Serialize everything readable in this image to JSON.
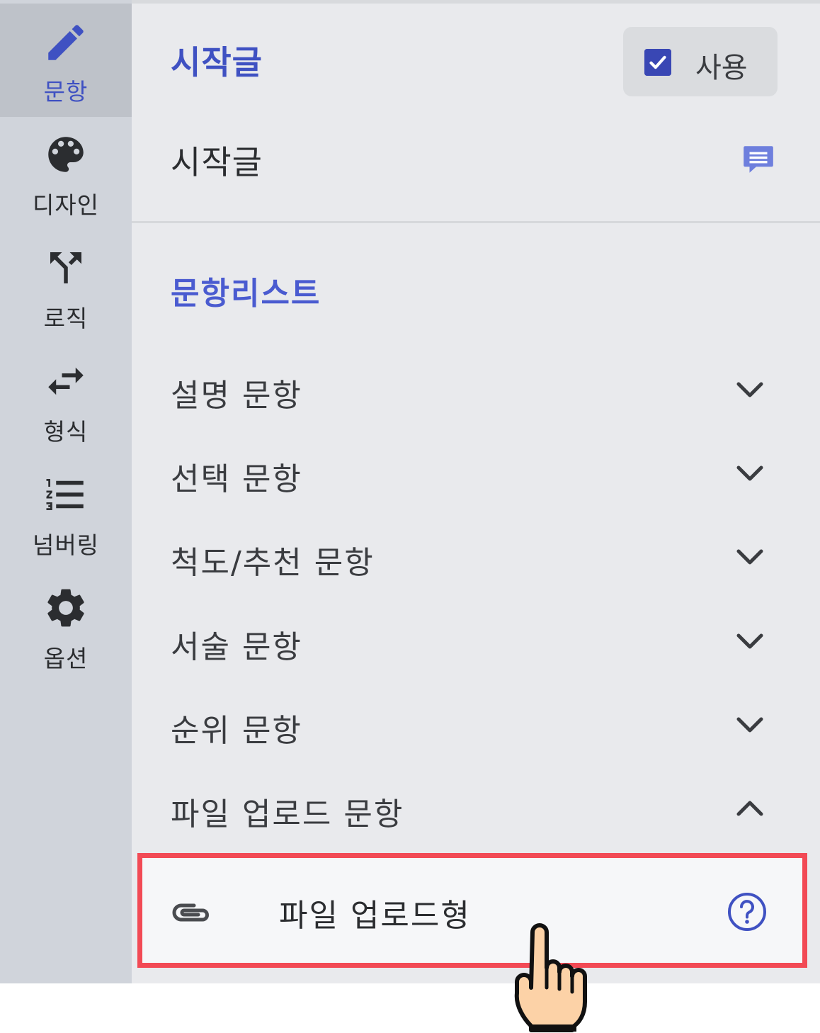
{
  "sidebar": {
    "items": [
      {
        "label": "문항",
        "icon": "pencil-icon",
        "active": true
      },
      {
        "label": "디자인",
        "icon": "palette-icon",
        "active": false
      },
      {
        "label": "로직",
        "icon": "fork-arrows-icon",
        "active": false
      },
      {
        "label": "형식",
        "icon": "swap-arrows-icon",
        "active": false
      },
      {
        "label": "넘버링",
        "icon": "numbered-list-icon",
        "active": false
      },
      {
        "label": "옵션",
        "icon": "gear-icon",
        "active": false
      }
    ]
  },
  "intro": {
    "title": "시작글",
    "use_label": "사용",
    "use_checked": true,
    "text": "시작글"
  },
  "question_list": {
    "title": "문항리스트",
    "categories": [
      {
        "label": "설명 문항",
        "expanded": false
      },
      {
        "label": "선택 문항",
        "expanded": false
      },
      {
        "label": "척도/추천 문항",
        "expanded": false
      },
      {
        "label": "서술 문항",
        "expanded": false
      },
      {
        "label": "순위 문항",
        "expanded": false
      },
      {
        "label": "파일 업로드 문항",
        "expanded": true
      }
    ],
    "expanded_items": [
      {
        "label": "파일 업로드형",
        "icon": "paperclip-icon"
      }
    ]
  },
  "colors": {
    "accent": "#3f51c2",
    "highlight": "#f24a55",
    "sidebar_bg": "#d0d4db",
    "panel_bg": "#e9eaed"
  }
}
